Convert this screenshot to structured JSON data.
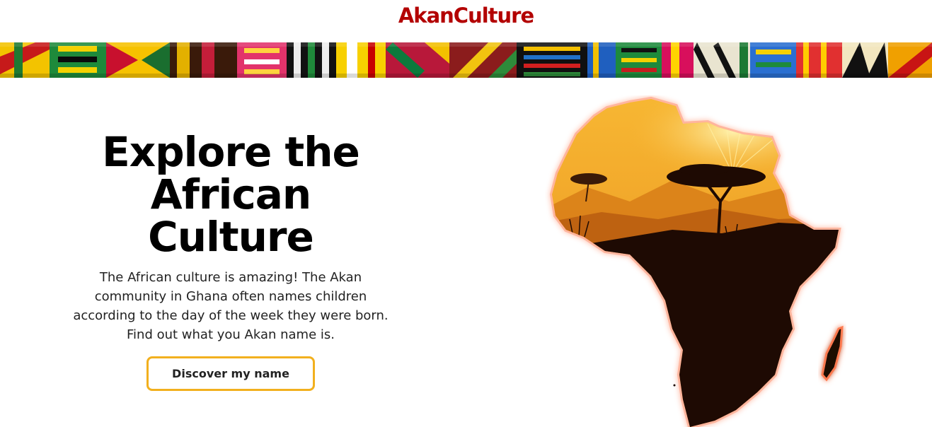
{
  "nav": {
    "brand": "AkanCulture"
  },
  "hero": {
    "title_line1": "Explore the",
    "title_line2": "African Culture",
    "description": "The African culture is amazing! The Akan community in Ghana often names children according to the day of the week they were born. Find out what you Akan name is.",
    "cta_label": "Discover my name"
  },
  "colors": {
    "brand": "#b30000",
    "cta_border": "#f2b01e",
    "map_sky": "#f6a825",
    "map_land": "#1e0a03"
  }
}
